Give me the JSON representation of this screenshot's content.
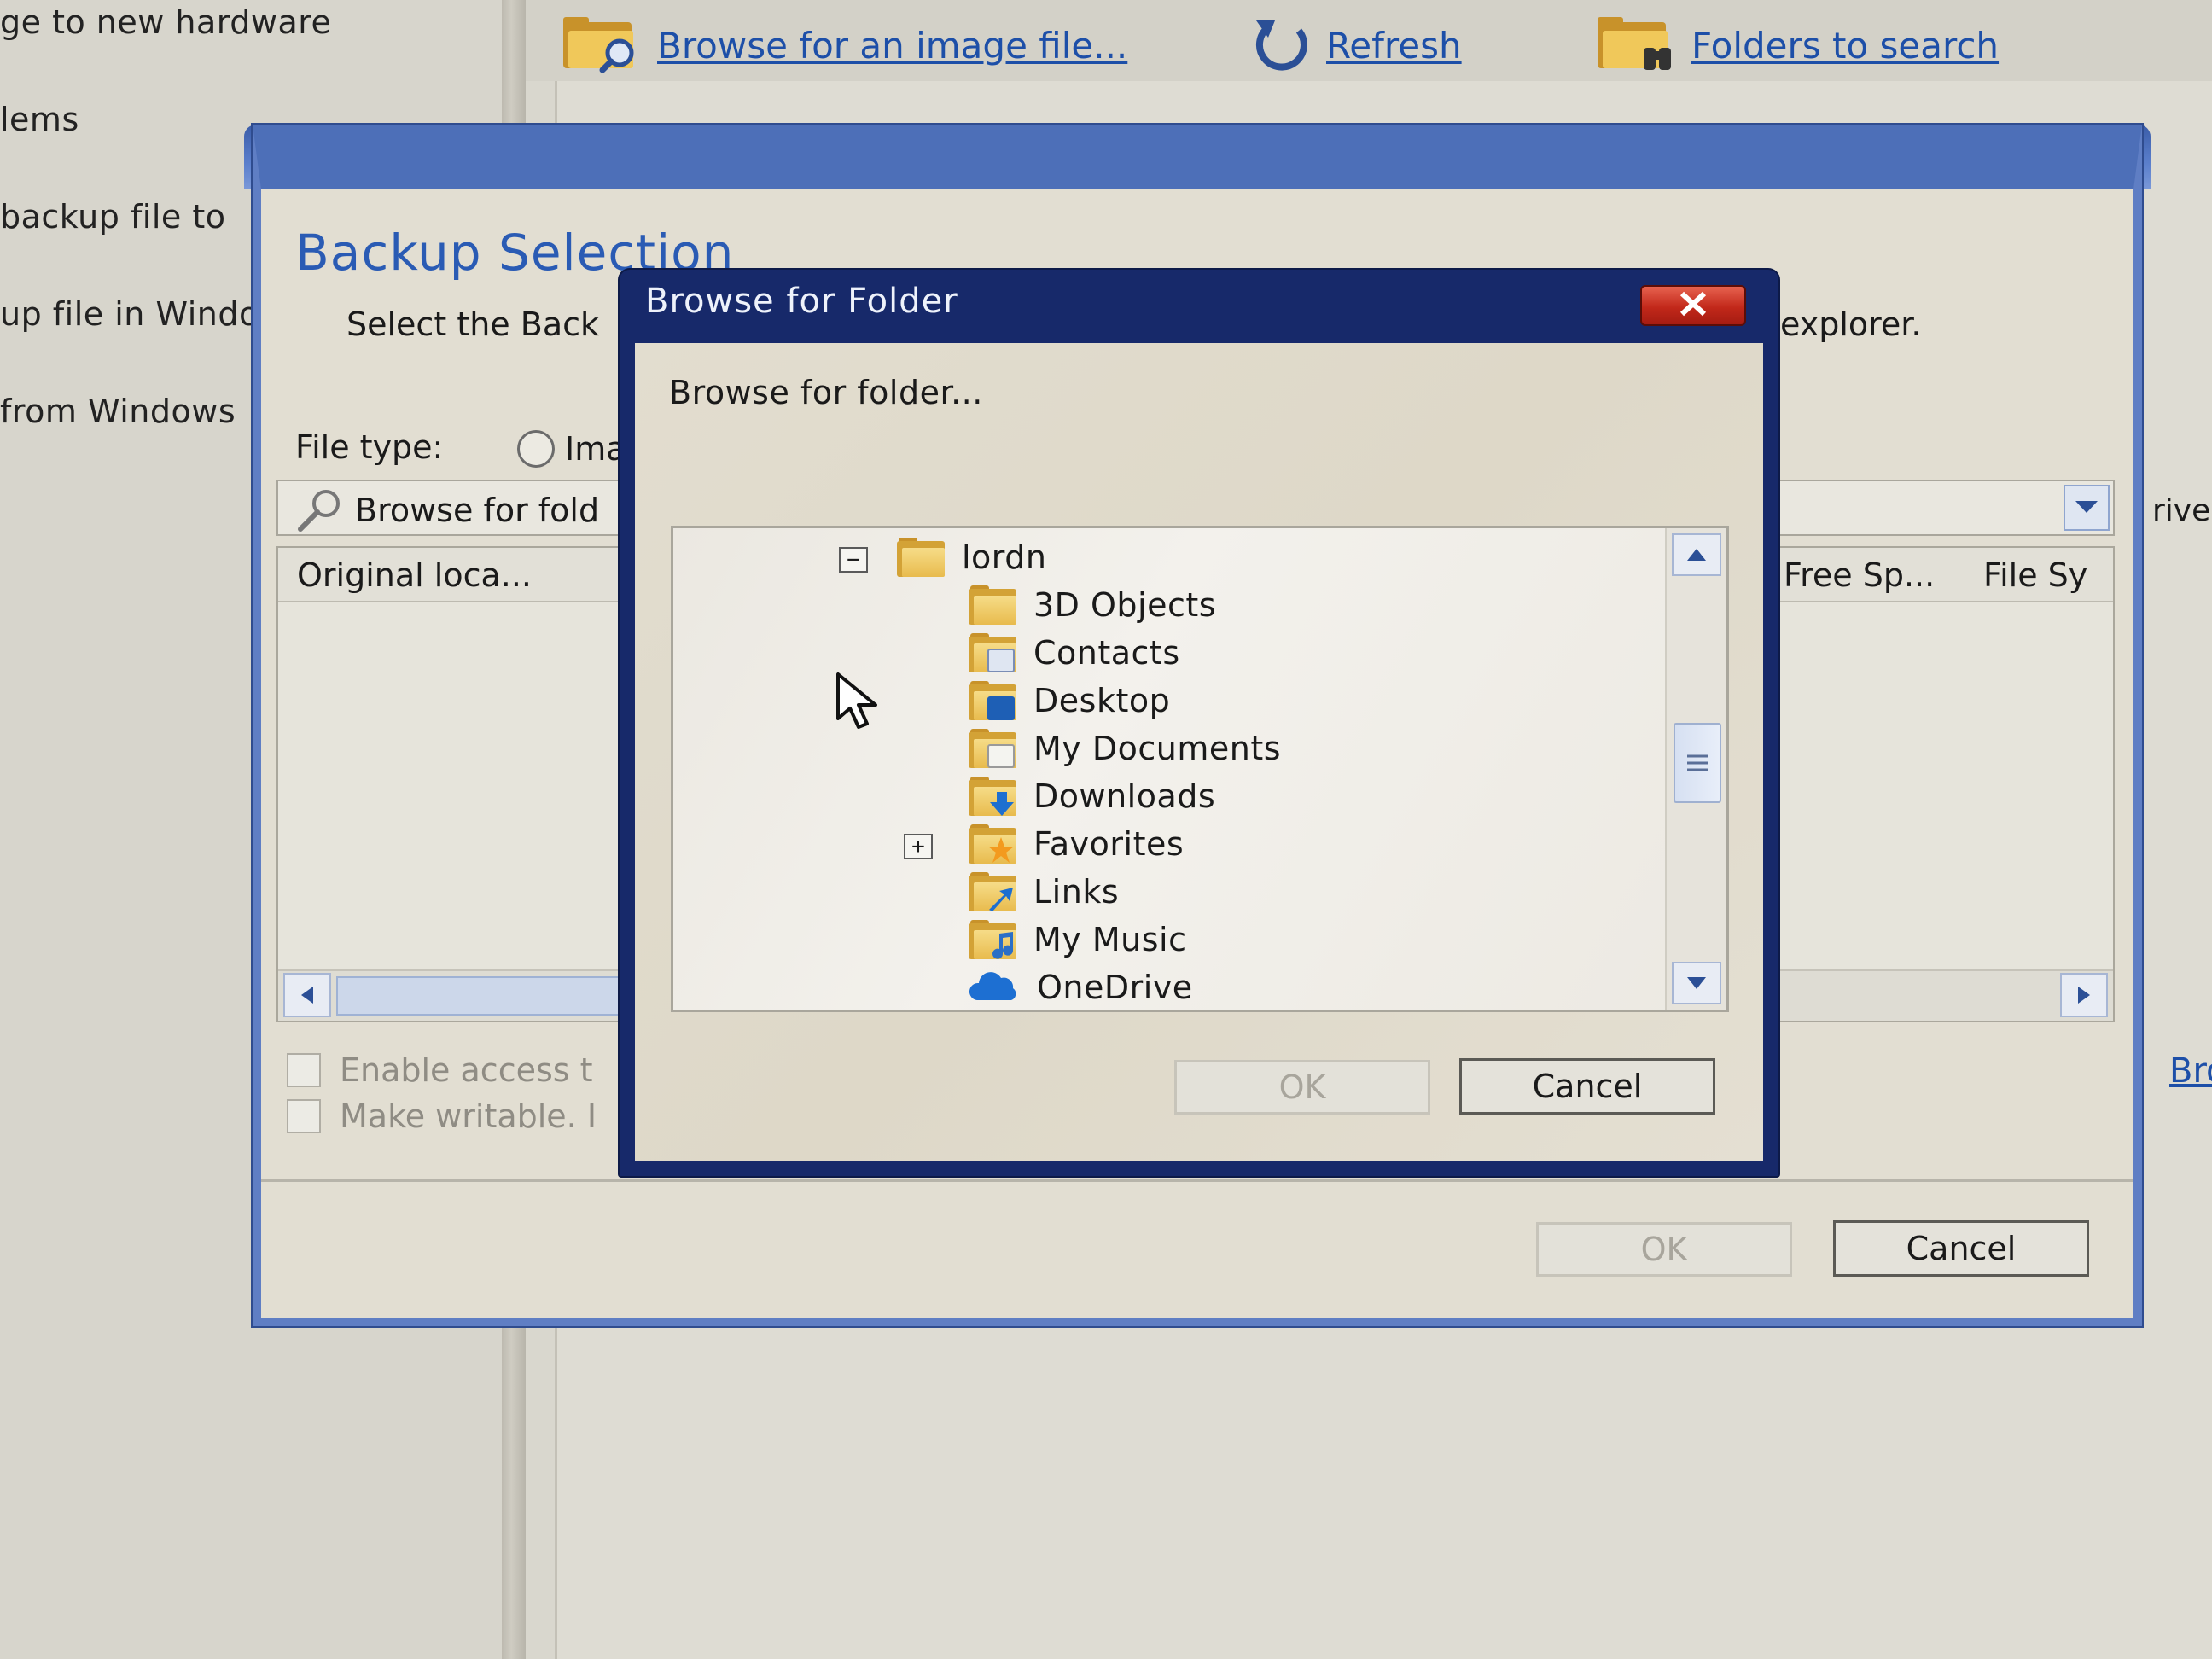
{
  "background_tasks": [
    "ge to new hardware",
    "lems",
    "backup file to",
    "up file in Windo",
    "from Windows"
  ],
  "toolbar": {
    "browse_image": "Browse for an image file...",
    "refresh": "Refresh",
    "folders_to_search": "Folders to search"
  },
  "backup_dialog": {
    "heading": "Backup Selection",
    "subtitle_left": "Select the Back",
    "subtitle_right": "explorer.",
    "file_type_label": "File type:",
    "radio_label": "Ima",
    "search_text": "Browse for fold",
    "drive_label": "rive",
    "columns": {
      "original_location": "Original loca...",
      "free_space": "Free Sp...",
      "file_system": "File Sy"
    },
    "browse_link": "Bro",
    "checkbox_enable_access": "Enable access t",
    "checkbox_make_writable": "Make writable. I",
    "ok_label": "OK",
    "cancel_label": "Cancel"
  },
  "browse_folder_dialog": {
    "title": "Browse for Folder",
    "prompt": "Browse for folder...",
    "tree": {
      "root": "lordn",
      "children": [
        {
          "label": "3D Objects",
          "icon": "folder-3d-objects-icon"
        },
        {
          "label": "Contacts",
          "icon": "folder-contacts-icon"
        },
        {
          "label": "Desktop",
          "icon": "folder-desktop-icon"
        },
        {
          "label": "My Documents",
          "icon": "folder-documents-icon"
        },
        {
          "label": "Downloads",
          "icon": "folder-downloads-icon"
        },
        {
          "label": "Favorites",
          "icon": "folder-favorites-icon",
          "expandable": true
        },
        {
          "label": "Links",
          "icon": "folder-links-icon"
        },
        {
          "label": "My Music",
          "icon": "folder-music-icon"
        },
        {
          "label": "OneDrive",
          "icon": "onedrive-cloud-icon"
        }
      ]
    },
    "ok_label": "OK",
    "cancel_label": "Cancel"
  },
  "colors": {
    "link_blue": "#1d4fa8",
    "dialog_titlebar": "#17296a",
    "heading_blue": "#2a5bb4",
    "close_red": "#c2281a",
    "folder_yellow": "#e8bb4d"
  }
}
